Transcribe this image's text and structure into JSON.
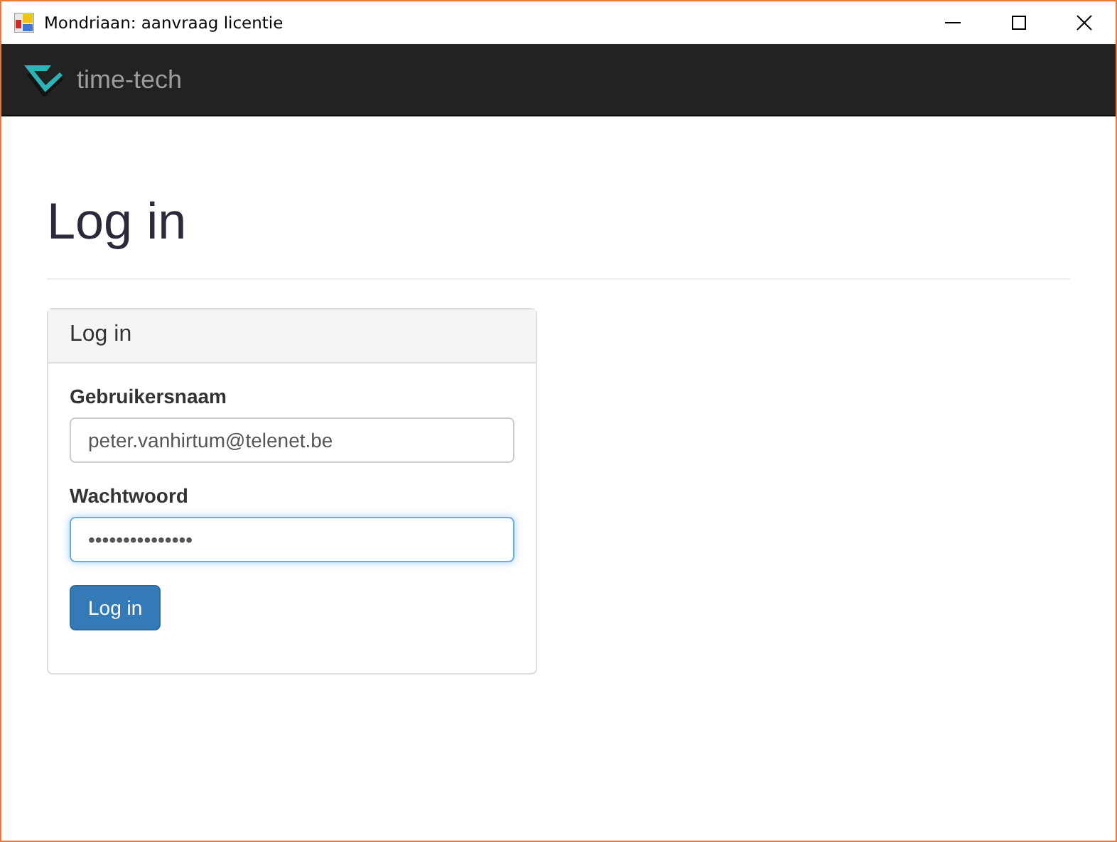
{
  "window": {
    "title": "Mondriaan: aanvraag licentie"
  },
  "navbar": {
    "brand": "time-tech"
  },
  "page": {
    "heading": "Log in"
  },
  "panel": {
    "title": "Log in",
    "fields": [
      {
        "label": "Gebruikersnaam",
        "value": "peter.vanhirtum@telenet.be",
        "focused": false
      },
      {
        "label": "Wachtwoord",
        "value": "•••••••••••••••",
        "focused": true
      }
    ],
    "button": "Log in"
  }
}
